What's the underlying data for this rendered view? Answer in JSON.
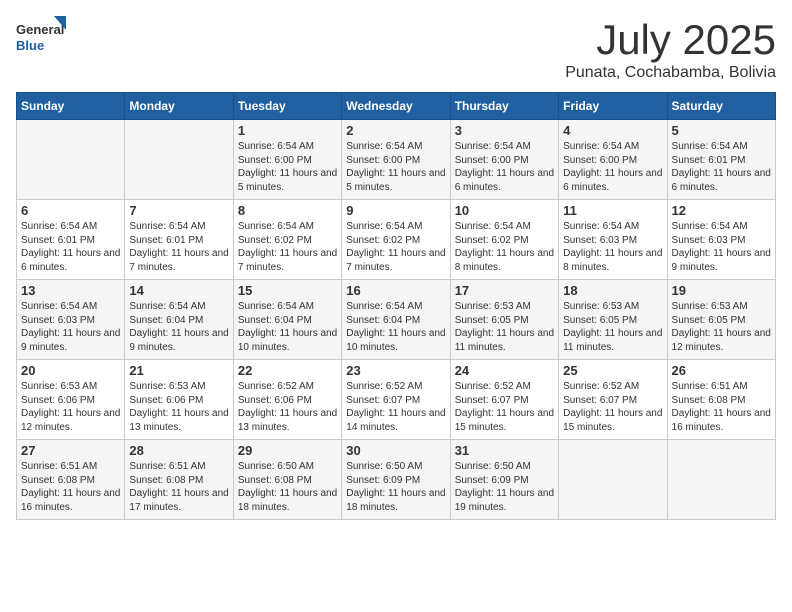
{
  "header": {
    "logo_general": "General",
    "logo_blue": "Blue",
    "month_title": "July 2025",
    "location": "Punata, Cochabamba, Bolivia"
  },
  "days_of_week": [
    "Sunday",
    "Monday",
    "Tuesday",
    "Wednesday",
    "Thursday",
    "Friday",
    "Saturday"
  ],
  "weeks": [
    [
      {
        "num": "",
        "detail": ""
      },
      {
        "num": "",
        "detail": ""
      },
      {
        "num": "1",
        "detail": "Sunrise: 6:54 AM\nSunset: 6:00 PM\nDaylight: 11 hours and 5 minutes."
      },
      {
        "num": "2",
        "detail": "Sunrise: 6:54 AM\nSunset: 6:00 PM\nDaylight: 11 hours and 5 minutes."
      },
      {
        "num": "3",
        "detail": "Sunrise: 6:54 AM\nSunset: 6:00 PM\nDaylight: 11 hours and 6 minutes."
      },
      {
        "num": "4",
        "detail": "Sunrise: 6:54 AM\nSunset: 6:00 PM\nDaylight: 11 hours and 6 minutes."
      },
      {
        "num": "5",
        "detail": "Sunrise: 6:54 AM\nSunset: 6:01 PM\nDaylight: 11 hours and 6 minutes."
      }
    ],
    [
      {
        "num": "6",
        "detail": "Sunrise: 6:54 AM\nSunset: 6:01 PM\nDaylight: 11 hours and 6 minutes."
      },
      {
        "num": "7",
        "detail": "Sunrise: 6:54 AM\nSunset: 6:01 PM\nDaylight: 11 hours and 7 minutes."
      },
      {
        "num": "8",
        "detail": "Sunrise: 6:54 AM\nSunset: 6:02 PM\nDaylight: 11 hours and 7 minutes."
      },
      {
        "num": "9",
        "detail": "Sunrise: 6:54 AM\nSunset: 6:02 PM\nDaylight: 11 hours and 7 minutes."
      },
      {
        "num": "10",
        "detail": "Sunrise: 6:54 AM\nSunset: 6:02 PM\nDaylight: 11 hours and 8 minutes."
      },
      {
        "num": "11",
        "detail": "Sunrise: 6:54 AM\nSunset: 6:03 PM\nDaylight: 11 hours and 8 minutes."
      },
      {
        "num": "12",
        "detail": "Sunrise: 6:54 AM\nSunset: 6:03 PM\nDaylight: 11 hours and 9 minutes."
      }
    ],
    [
      {
        "num": "13",
        "detail": "Sunrise: 6:54 AM\nSunset: 6:03 PM\nDaylight: 11 hours and 9 minutes."
      },
      {
        "num": "14",
        "detail": "Sunrise: 6:54 AM\nSunset: 6:04 PM\nDaylight: 11 hours and 9 minutes."
      },
      {
        "num": "15",
        "detail": "Sunrise: 6:54 AM\nSunset: 6:04 PM\nDaylight: 11 hours and 10 minutes."
      },
      {
        "num": "16",
        "detail": "Sunrise: 6:54 AM\nSunset: 6:04 PM\nDaylight: 11 hours and 10 minutes."
      },
      {
        "num": "17",
        "detail": "Sunrise: 6:53 AM\nSunset: 6:05 PM\nDaylight: 11 hours and 11 minutes."
      },
      {
        "num": "18",
        "detail": "Sunrise: 6:53 AM\nSunset: 6:05 PM\nDaylight: 11 hours and 11 minutes."
      },
      {
        "num": "19",
        "detail": "Sunrise: 6:53 AM\nSunset: 6:05 PM\nDaylight: 11 hours and 12 minutes."
      }
    ],
    [
      {
        "num": "20",
        "detail": "Sunrise: 6:53 AM\nSunset: 6:06 PM\nDaylight: 11 hours and 12 minutes."
      },
      {
        "num": "21",
        "detail": "Sunrise: 6:53 AM\nSunset: 6:06 PM\nDaylight: 11 hours and 13 minutes."
      },
      {
        "num": "22",
        "detail": "Sunrise: 6:52 AM\nSunset: 6:06 PM\nDaylight: 11 hours and 13 minutes."
      },
      {
        "num": "23",
        "detail": "Sunrise: 6:52 AM\nSunset: 6:07 PM\nDaylight: 11 hours and 14 minutes."
      },
      {
        "num": "24",
        "detail": "Sunrise: 6:52 AM\nSunset: 6:07 PM\nDaylight: 11 hours and 15 minutes."
      },
      {
        "num": "25",
        "detail": "Sunrise: 6:52 AM\nSunset: 6:07 PM\nDaylight: 11 hours and 15 minutes."
      },
      {
        "num": "26",
        "detail": "Sunrise: 6:51 AM\nSunset: 6:08 PM\nDaylight: 11 hours and 16 minutes."
      }
    ],
    [
      {
        "num": "27",
        "detail": "Sunrise: 6:51 AM\nSunset: 6:08 PM\nDaylight: 11 hours and 16 minutes."
      },
      {
        "num": "28",
        "detail": "Sunrise: 6:51 AM\nSunset: 6:08 PM\nDaylight: 11 hours and 17 minutes."
      },
      {
        "num": "29",
        "detail": "Sunrise: 6:50 AM\nSunset: 6:08 PM\nDaylight: 11 hours and 18 minutes."
      },
      {
        "num": "30",
        "detail": "Sunrise: 6:50 AM\nSunset: 6:09 PM\nDaylight: 11 hours and 18 minutes."
      },
      {
        "num": "31",
        "detail": "Sunrise: 6:50 AM\nSunset: 6:09 PM\nDaylight: 11 hours and 19 minutes."
      },
      {
        "num": "",
        "detail": ""
      },
      {
        "num": "",
        "detail": ""
      }
    ]
  ]
}
